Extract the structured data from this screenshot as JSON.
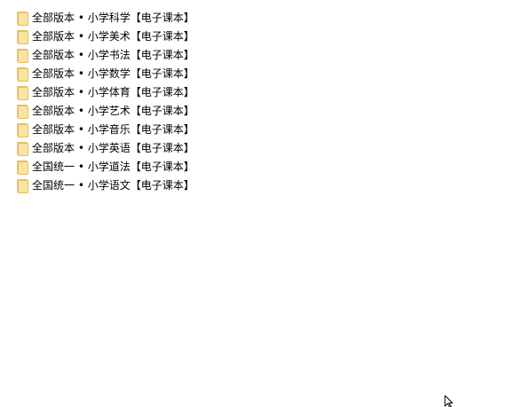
{
  "folders": [
    {
      "label": "全部版本 • 小学科学【电子课本】",
      "icon": "folder-icon"
    },
    {
      "label": "全部版本 • 小学美术【电子课本】",
      "icon": "folder-icon"
    },
    {
      "label": "全部版本 • 小学书法【电子课本】",
      "icon": "folder-icon"
    },
    {
      "label": "全部版本 • 小学数学【电子课本】",
      "icon": "folder-icon"
    },
    {
      "label": "全部版本 • 小学体育【电子课本】",
      "icon": "folder-icon"
    },
    {
      "label": "全部版本 • 小学艺术【电子课本】",
      "icon": "folder-icon"
    },
    {
      "label": "全部版本 • 小学音乐【电子课本】",
      "icon": "folder-icon"
    },
    {
      "label": "全部版本 • 小学英语【电子课本】",
      "icon": "folder-icon"
    },
    {
      "label": "全国统一 • 小学道法【电子课本】",
      "icon": "folder-icon"
    },
    {
      "label": "全国统一 • 小学语文【电子课本】",
      "icon": "folder-icon"
    }
  ],
  "colors": {
    "folder_fill": "#fbe3a2",
    "folder_border": "#e3bf63",
    "background": "#ffffff",
    "text": "#000000"
  },
  "cursor_icon": "mouse-pointer-icon"
}
